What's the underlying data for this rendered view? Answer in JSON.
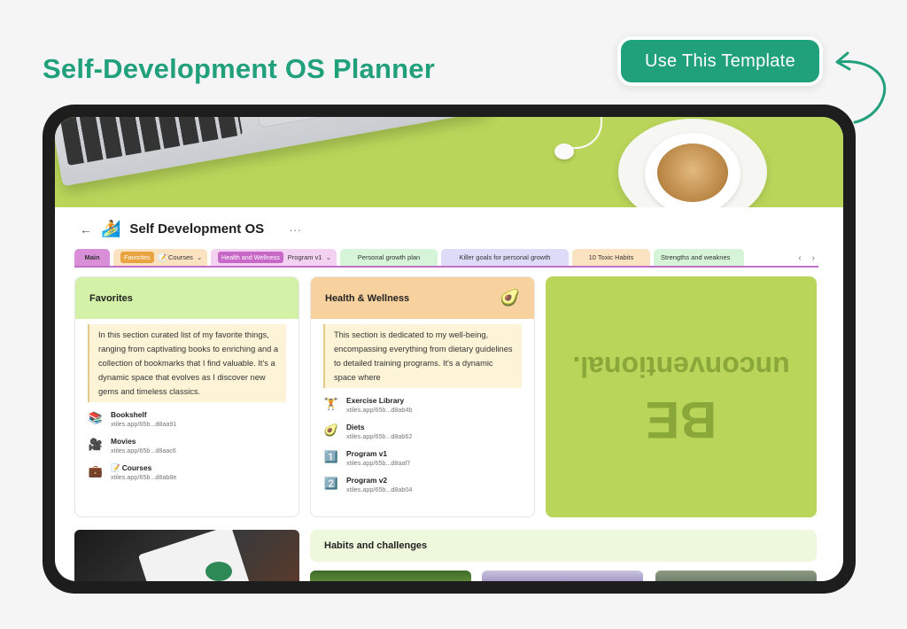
{
  "hero": {
    "title": "Self-Development OS Planner",
    "cta_label": "Use This Template"
  },
  "app": {
    "back_glyph": "←",
    "emoji": "🏄",
    "title": "Self Development OS",
    "more_glyph": "···"
  },
  "tabs": [
    {
      "label": "Main"
    },
    {
      "chip": "Favorites",
      "label": "📝 Courses"
    },
    {
      "chip": "Health and Wellness",
      "label": "Program v1"
    },
    {
      "label": "Personal growth plan"
    },
    {
      "label": "Killer goals for personal growth"
    },
    {
      "label": "10 Toxic Habits"
    },
    {
      "label": "Strengths and weaknes"
    }
  ],
  "tab_nav": {
    "prev": "‹",
    "next": "›"
  },
  "favorites": {
    "title": "Favorites",
    "description": "In this section curated list of my favorite things, ranging from captivating books  to enriching   and a collection of bookmarks that I find valuable. It's a dynamic space that evolves as I discover new gems and timeless classics.",
    "links": [
      {
        "icon": "📚",
        "name": "Bookshelf",
        "url": "xtiles.app/65b...d8aa91"
      },
      {
        "icon": "🎥",
        "name": "Movies",
        "url": "xtiles.app/65b...d8aac6"
      },
      {
        "icon": "💼",
        "name": "📝 Courses",
        "url": "xtiles.app/65b...d8ab8e"
      }
    ]
  },
  "health": {
    "title": "Health & Wellness",
    "emoji": "🥑",
    "description": "This section is dedicated to my well-being, encompassing everything from dietary guidelines to detailed training programs. It's a dynamic space where",
    "links": [
      {
        "icon": "🏋",
        "name": "Exercise Library",
        "url": "xtiles.app/65b...d8ab4b"
      },
      {
        "icon": "🥑",
        "name": "Diets",
        "url": "xtiles.app/65b...d8ab62"
      },
      {
        "icon": "1️⃣",
        "name": "Program v1",
        "url": "xtiles.app/65b...d8aaf7"
      },
      {
        "icon": "2️⃣",
        "name": "Program v2",
        "url": "xtiles.app/65b...d8ab04"
      }
    ]
  },
  "motto": {
    "line1": "BE",
    "line2": "unconventional."
  },
  "habits": {
    "title": "Habits and challenges"
  },
  "colors": {
    "brand": "#21a07c",
    "lime": "#b9d65a",
    "main_tab": "#d98ed8",
    "favorites_chip": "#e9a441",
    "health_chip": "#c768c7"
  }
}
